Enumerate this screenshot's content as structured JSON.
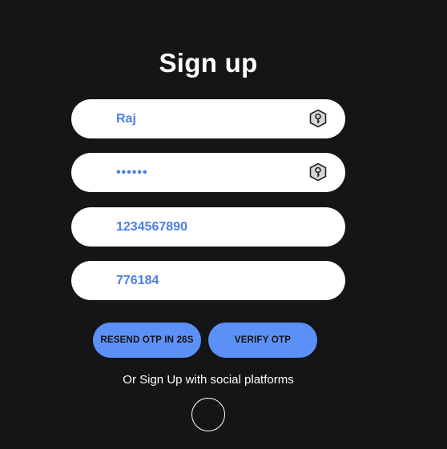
{
  "form": {
    "title": "Sign up",
    "fields": [
      {
        "value": "Raj",
        "icon": "key-hexagon-icon"
      },
      {
        "value": "••••••",
        "icon": "key-hexagon-icon"
      },
      {
        "value": "1234567890"
      },
      {
        "value": "776184"
      }
    ],
    "resend_label": "RESEND OTP IN 26S",
    "verify_label": "VERIFY OTP",
    "social_text": "Or Sign Up with social platforms"
  },
  "colors": {
    "background": "#151517",
    "field_text": "#4b7ee6",
    "button": "#5b91f7"
  }
}
